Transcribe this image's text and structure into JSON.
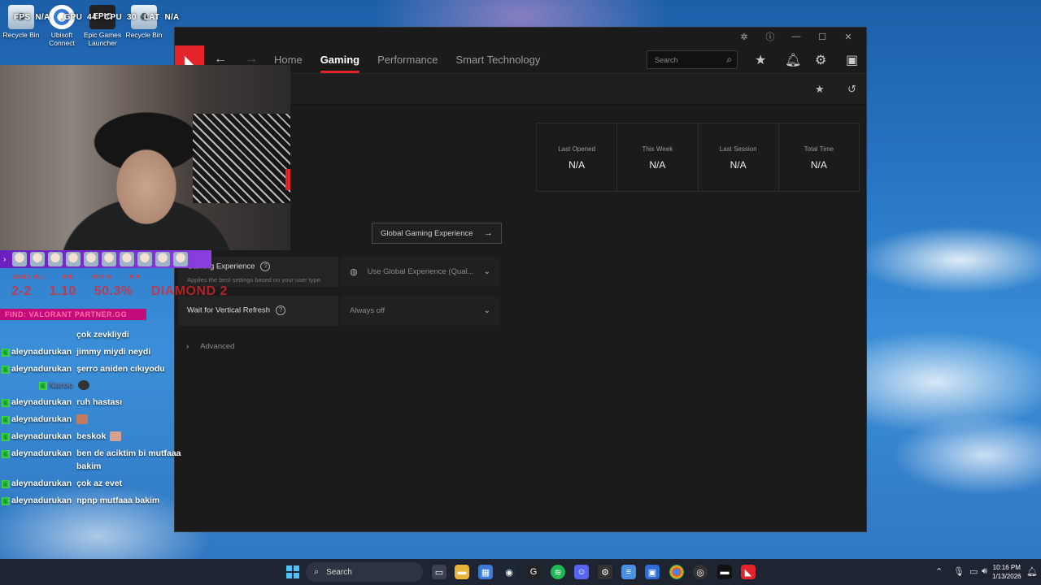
{
  "desktop": {
    "icons": [
      {
        "label": "Recycle Bin",
        "icon": "recycle-bin-icon"
      },
      {
        "label": "Ubisoft Connect",
        "icon": "ubisoft-icon"
      },
      {
        "label": "Epic Games Launcher",
        "icon": "epic-games-icon"
      },
      {
        "label": "Recycle Bin",
        "icon": "recycle-bin-icon"
      }
    ],
    "epic_glyph": "EPIC",
    "overlay": {
      "fps_label": "FPS",
      "fps_value": "N/A",
      "gpu_label": "GPU",
      "gpu_value": "44",
      "cpu_label": "CPU",
      "cpu_value": "30",
      "lat_label": "LAT",
      "lat_value": "N/A"
    }
  },
  "amd": {
    "titlebar": {
      "bug": "bug-icon",
      "help": "help-icon",
      "minimize": "—",
      "maximize": "☐",
      "close": "✕"
    },
    "logo": "◣",
    "nav": {
      "back": "←",
      "forward": "→",
      "tabs": [
        {
          "label": "Home"
        },
        {
          "label": "Gaming",
          "active": true
        },
        {
          "label": "Performance"
        },
        {
          "label": "Smart Technology"
        }
      ],
      "search_placeholder": "Search"
    },
    "stats": [
      {
        "label": "Last Opened",
        "value": "N/A"
      },
      {
        "label": "This Week",
        "value": "N/A"
      },
      {
        "label": "Last Session",
        "value": "N/A"
      },
      {
        "label": "Total Time",
        "value": "N/A"
      }
    ],
    "global_button": "Global Gaming Experience",
    "settings": [
      {
        "label": "Gaming Experience",
        "sub": "Applies the best settings based on your user type.",
        "value": "Use Global Experience (Qual..."
      },
      {
        "label": "Wait for Vertical Refresh",
        "sub": "",
        "value": "Always off"
      }
    ],
    "advanced": "Advanced",
    "accent": "#e4242b"
  },
  "stream": {
    "stats_labels": [
      "DAILY W/L",
      "K/D",
      "WIN %",
      "R.R"
    ],
    "stats_values": [
      "2-2",
      "1.10",
      "50.3%",
      "DIAMOND 2"
    ],
    "team_bar": "FIND: VALORANT PARTNER.GG",
    "chat": [
      {
        "user": "",
        "msg": "çok zevkliydi"
      },
      {
        "user": "aleynadurukan",
        "msg": "jimmy miydi neydi"
      },
      {
        "user": "aleynadurukan",
        "msg": "şerro aniden cıkıyodu"
      },
      {
        "user": "Naroc",
        "msg": ""
      },
      {
        "user": "aleynadurukan",
        "msg": "ruh hastası"
      },
      {
        "user": "aleynadurukan",
        "msg": ""
      },
      {
        "user": "aleynadurukan",
        "msg": "beskok"
      },
      {
        "user": "aleynadurukan",
        "msg": "ben de aciktim bi mutfaaa"
      },
      {
        "user": "",
        "msg": "bakim"
      },
      {
        "user": "aleynadurukan",
        "msg": "çok az evet"
      },
      {
        "user": "aleynadurukan",
        "msg": "npnp mutfaaa bakim"
      }
    ]
  },
  "taskbar": {
    "search": "Search",
    "time": "10:16 PM",
    "date": "1/13/2026"
  }
}
